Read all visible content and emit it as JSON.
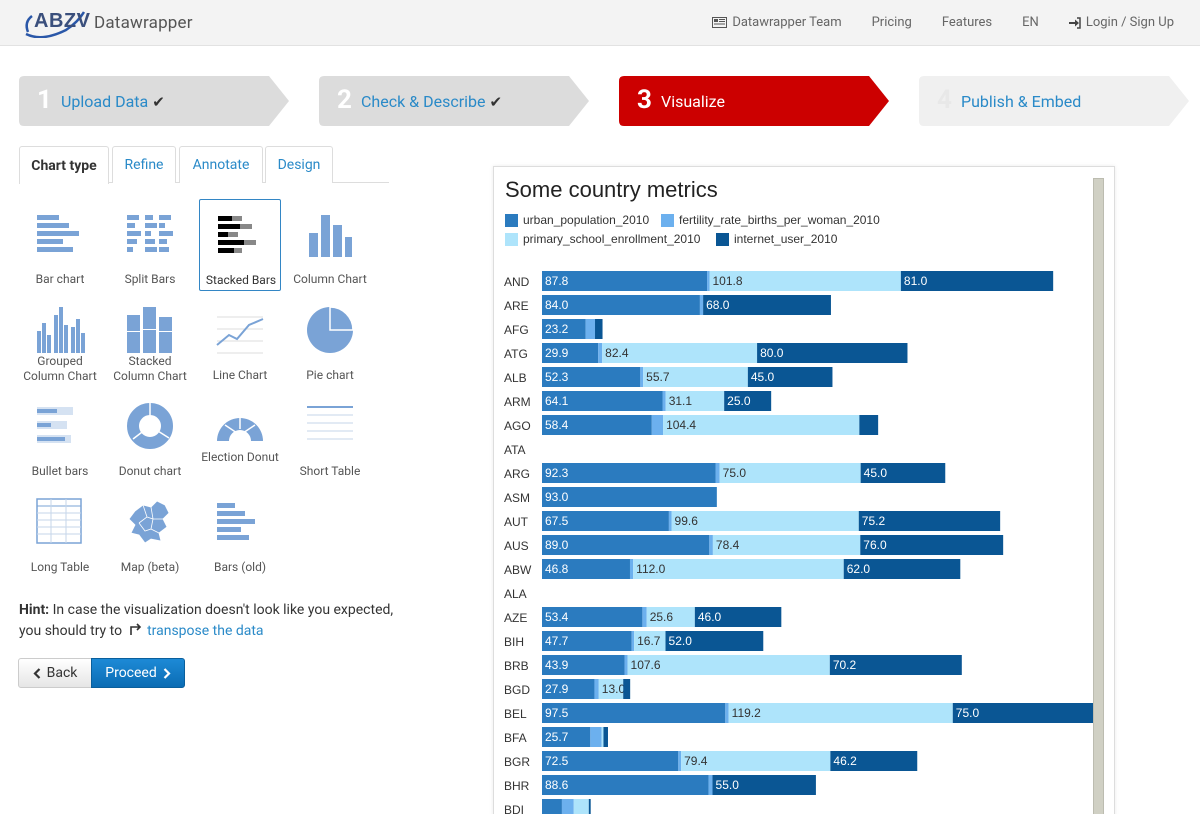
{
  "header": {
    "logo_text": "ABZV",
    "app_name": "Datawrapper",
    "nav": {
      "team": "Datawrapper Team",
      "pricing": "Pricing",
      "features": "Features",
      "lang": "EN",
      "login": "Login / Sign Up"
    }
  },
  "steps": [
    {
      "num": "1",
      "label": "Upload Data",
      "check": "✔"
    },
    {
      "num": "2",
      "label": "Check & Describe",
      "check": "✔"
    },
    {
      "num": "3",
      "label": "Visualize",
      "check": ""
    },
    {
      "num": "4",
      "label": "Publish & Embed",
      "check": ""
    }
  ],
  "tabs": [
    "Chart type",
    "Refine",
    "Annotate",
    "Design"
  ],
  "chart_types": [
    {
      "name": "Bar chart",
      "icon": "bar-chart-icon"
    },
    {
      "name": "Split Bars",
      "icon": "split-bars-icon"
    },
    {
      "name": "Stacked Bars",
      "icon": "stacked-bars-icon"
    },
    {
      "name": "Column Chart",
      "icon": "column-chart-icon"
    },
    {
      "name": "Grouped Column Chart",
      "icon": "grouped-column-icon"
    },
    {
      "name": "Stacked Column Chart",
      "icon": "stacked-column-icon"
    },
    {
      "name": "Line Chart",
      "icon": "line-chart-icon"
    },
    {
      "name": "Pie chart",
      "icon": "pie-chart-icon"
    },
    {
      "name": "Bullet bars",
      "icon": "bullet-bars-icon"
    },
    {
      "name": "Donut chart",
      "icon": "donut-chart-icon"
    },
    {
      "name": "Election Donut",
      "icon": "election-donut-icon"
    },
    {
      "name": "Short Table",
      "icon": "short-table-icon"
    },
    {
      "name": "Long Table",
      "icon": "long-table-icon"
    },
    {
      "name": "Map (beta)",
      "icon": "map-icon"
    },
    {
      "name": "Bars (old)",
      "icon": "bars-old-icon"
    }
  ],
  "hint": {
    "label": "Hint:",
    "text": "In case the visualization doesn't look like you expected, you should try to",
    "link": "transpose the data"
  },
  "buttons": {
    "back": "Back",
    "proceed": "Proceed"
  },
  "colors": {
    "s0": "#2b7bbf",
    "s1": "#6cb0ee",
    "s2": "#aee4fb",
    "s3": "#0a5694",
    "active_step": "#cc0000"
  },
  "chart_data": {
    "type": "stacked-bar",
    "title": "Some country metrics",
    "series": [
      {
        "name": "urban_population_2010"
      },
      {
        "name": "fertility_rate_births_per_woman_2010"
      },
      {
        "name": "primary_school_enrollment_2010"
      },
      {
        "name": "internet_user_2010"
      }
    ],
    "rows": [
      {
        "label": "AND",
        "values": [
          87.8,
          1.3,
          101.8,
          81.0
        ]
      },
      {
        "label": "ARE",
        "values": [
          84.0,
          1.7,
          null,
          68.0
        ]
      },
      {
        "label": "AFG",
        "values": [
          23.2,
          5.0,
          null,
          4.0
        ]
      },
      {
        "label": "ATG",
        "values": [
          29.9,
          2.1,
          82.4,
          80.0
        ]
      },
      {
        "label": "ALB",
        "values": [
          52.3,
          1.5,
          55.7,
          45.0
        ]
      },
      {
        "label": "ARM",
        "values": [
          64.1,
          1.7,
          31.1,
          25.0
        ]
      },
      {
        "label": "AGO",
        "values": [
          58.4,
          6.0,
          104.4,
          10.0
        ]
      },
      {
        "label": "ATA",
        "values": [
          null,
          null,
          null,
          null
        ]
      },
      {
        "label": "ARG",
        "values": [
          92.3,
          2.2,
          75.0,
          45.0
        ]
      },
      {
        "label": "ASM",
        "values": [
          93.0,
          null,
          null,
          null
        ]
      },
      {
        "label": "AUT",
        "values": [
          67.5,
          1.4,
          99.6,
          75.2
        ]
      },
      {
        "label": "AUS",
        "values": [
          89.0,
          1.9,
          78.4,
          76.0
        ]
      },
      {
        "label": "ABW",
        "values": [
          46.8,
          1.7,
          112.0,
          62.0
        ]
      },
      {
        "label": "ALA",
        "values": [
          null,
          null,
          null,
          null
        ]
      },
      {
        "label": "AZE",
        "values": [
          53.4,
          2.3,
          25.6,
          46.0
        ]
      },
      {
        "label": "BIH",
        "values": [
          47.7,
          1.3,
          16.7,
          52.0
        ]
      },
      {
        "label": "BRB",
        "values": [
          43.9,
          1.6,
          107.6,
          70.2
        ]
      },
      {
        "label": "BGD",
        "values": [
          27.9,
          2.3,
          13.0,
          3.7
        ]
      },
      {
        "label": "BEL",
        "values": [
          97.5,
          1.8,
          119.2,
          75.0
        ]
      },
      {
        "label": "BFA",
        "values": [
          25.7,
          6.0,
          1.0,
          2.4
        ]
      },
      {
        "label": "BGR",
        "values": [
          72.5,
          1.5,
          79.4,
          46.2
        ]
      },
      {
        "label": "BHR",
        "values": [
          88.6,
          2.1,
          null,
          55.0
        ]
      },
      {
        "label": "BDI",
        "values": [
          10.6,
          6.3,
          8.0,
          1.0
        ]
      }
    ]
  }
}
